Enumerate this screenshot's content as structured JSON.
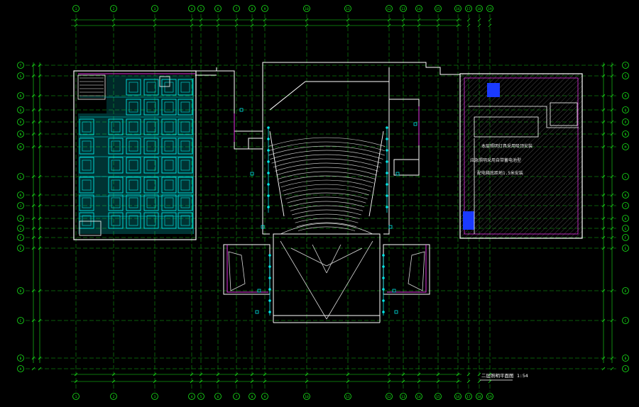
{
  "drawing": {
    "title": "二层照明平面图",
    "scale": "1:54",
    "colors": {
      "background": "#000000",
      "grid": "#19e619",
      "wall": "#ffffff",
      "lighting": "#00e6e6",
      "equipment": "#1a3aff",
      "partition": "#e633e6",
      "seating": "#bdbdbd",
      "stage": "#d8d8d8"
    },
    "top_axes": [
      "1",
      "2",
      "3",
      "4",
      "5",
      "6",
      "7",
      "8",
      "9",
      "10",
      "11",
      "12",
      "13",
      "14",
      "15",
      "16",
      "17",
      "18",
      "19"
    ],
    "left_axes": [
      "T",
      "S",
      "R",
      "Q",
      "P",
      "N",
      "M",
      "L",
      "K",
      "J",
      "H",
      "G",
      "F",
      "E",
      "D",
      "C",
      "B",
      "A"
    ],
    "notes": [
      "本层照明灯具采用吸顶安装",
      "应急照明采用自带蓄电池型",
      "配电箱底距地1.5米安装"
    ]
  }
}
